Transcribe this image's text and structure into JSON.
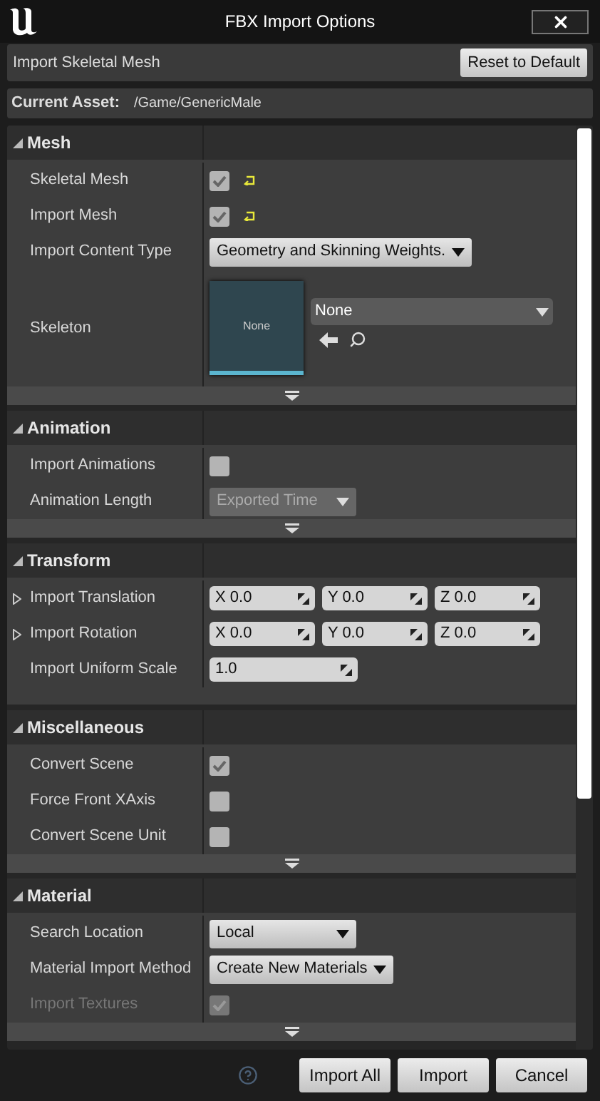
{
  "window": {
    "title": "FBX Import Options"
  },
  "header": {
    "title": "Import Skeletal Mesh",
    "reset_button": "Reset to Default"
  },
  "current_asset": {
    "label": "Current Asset:",
    "value": "/Game/GenericMale"
  },
  "sections": [
    {
      "title": "Mesh",
      "expanded": true,
      "show_more": true,
      "rows": [
        {
          "kind": "checkbox",
          "label": "Skeletal Mesh",
          "checked": true,
          "reset": true,
          "disabled": false
        },
        {
          "kind": "checkbox",
          "label": "Import Mesh",
          "checked": true,
          "reset": true,
          "disabled": false
        },
        {
          "kind": "dropdown",
          "label": "Import Content Type",
          "value": "Geometry and Skinning Weights.",
          "disabled": false
        },
        {
          "kind": "asset",
          "label": "Skeleton",
          "thumbnail": "None",
          "value": "None"
        }
      ]
    },
    {
      "title": "Animation",
      "expanded": true,
      "show_more": true,
      "rows": [
        {
          "kind": "checkbox",
          "label": "Import Animations",
          "checked": false,
          "reset": false,
          "disabled": false
        },
        {
          "kind": "dropdown",
          "label": "Animation Length",
          "value": "Exported Time",
          "disabled": true
        }
      ]
    },
    {
      "title": "Transform",
      "expanded": true,
      "show_more": false,
      "rows": [
        {
          "kind": "vector",
          "label": "Import Translation",
          "expanded": false,
          "fields": [
            {
              "axis": "X",
              "value": "0.0"
            },
            {
              "axis": "Y",
              "value": "0.0"
            },
            {
              "axis": "Z",
              "value": "0.0"
            }
          ]
        },
        {
          "kind": "vector",
          "label": "Import Rotation",
          "expanded": false,
          "fields": [
            {
              "axis": "X",
              "value": "0.0"
            },
            {
              "axis": "Y",
              "value": "0.0"
            },
            {
              "axis": "Z",
              "value": "0.0"
            }
          ]
        },
        {
          "kind": "number",
          "label": "Import Uniform Scale",
          "value": "1.0"
        }
      ]
    },
    {
      "title": "Miscellaneous",
      "expanded": true,
      "show_more": true,
      "rows": [
        {
          "kind": "checkbox",
          "label": "Convert Scene",
          "checked": true,
          "reset": false,
          "disabled": false
        },
        {
          "kind": "checkbox",
          "label": "Force Front XAxis",
          "checked": false,
          "reset": false,
          "disabled": false
        },
        {
          "kind": "checkbox",
          "label": "Convert Scene Unit",
          "checked": false,
          "reset": false,
          "disabled": false
        }
      ]
    },
    {
      "title": "Material",
      "expanded": true,
      "show_more": true,
      "rows": [
        {
          "kind": "dropdown",
          "label": "Search Location",
          "value": "Local",
          "disabled": false
        },
        {
          "kind": "dropdown",
          "label": "Material Import Method",
          "value": "Create New Materials",
          "disabled": false
        },
        {
          "kind": "checkbox",
          "label": "Import Textures",
          "checked": true,
          "reset": false,
          "disabled": true
        }
      ]
    }
  ],
  "buttons": [
    "Import All",
    "Import",
    "Cancel"
  ]
}
